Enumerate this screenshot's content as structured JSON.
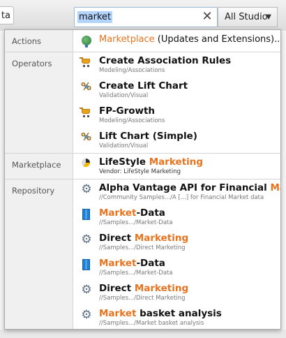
{
  "toolbar": {
    "prev_tab_label": "ta",
    "search": {
      "value": "market"
    },
    "scope_select": {
      "selected": "All Studio"
    }
  },
  "results": {
    "sections": [
      {
        "label": "Actions",
        "items": [
          {
            "icon": "globe-icon",
            "parts": [
              {
                "t": "Marketplace",
                "hl": true
              },
              {
                "t": " (Updates and Extensions)...",
                "hl": false
              }
            ],
            "subtitle": ""
          }
        ]
      },
      {
        "label": "Operators",
        "items": [
          {
            "icon": "cart-icon",
            "parts": [
              {
                "t": "Create Association Rules",
                "hl": false
              }
            ],
            "subtitle": "Modeling/Associations"
          },
          {
            "icon": "percent-icon",
            "parts": [
              {
                "t": "Create Lift Chart",
                "hl": false
              }
            ],
            "subtitle": "Validation/Visual"
          },
          {
            "icon": "cart-icon",
            "parts": [
              {
                "t": "FP-Growth",
                "hl": false
              }
            ],
            "subtitle": "Modeling/Associations"
          },
          {
            "icon": "percent-icon",
            "parts": [
              {
                "t": "Lift Chart (Simple)",
                "hl": false
              }
            ],
            "subtitle": "Validation/Visual"
          }
        ]
      },
      {
        "label": "Marketplace",
        "items": [
          {
            "icon": "pie-chart-icon",
            "parts": [
              {
                "t": "LifeStyle ",
                "hl": false
              },
              {
                "t": "Marketing",
                "hl": true
              }
            ],
            "subtitle": "Vendor: LifeStyle Marketing"
          }
        ]
      },
      {
        "label": "Repository",
        "items": [
          {
            "icon": "gear-icon",
            "parts": [
              {
                "t": "Alpha Vantage API for Financial ",
                "hl": false
              },
              {
                "t": "Ma",
                "hl": true
              }
            ],
            "subtitle": "//Community Samples.../A [...] for Financial Market data"
          },
          {
            "icon": "data-file-icon",
            "parts": [
              {
                "t": "Market",
                "hl": true
              },
              {
                "t": "-Data",
                "hl": false
              }
            ],
            "subtitle": "//Samples.../Market-Data"
          },
          {
            "icon": "gear-icon",
            "parts": [
              {
                "t": "Direct ",
                "hl": false
              },
              {
                "t": "Marketing",
                "hl": true
              }
            ],
            "subtitle": "//Samples.../Direct Marketing"
          },
          {
            "icon": "data-file-icon",
            "parts": [
              {
                "t": "Market",
                "hl": true
              },
              {
                "t": "-Data",
                "hl": false
              }
            ],
            "subtitle": "//Samples.../Market-Data"
          },
          {
            "icon": "gear-icon",
            "parts": [
              {
                "t": "Direct ",
                "hl": false
              },
              {
                "t": "Marketing",
                "hl": true
              }
            ],
            "subtitle": "//Samples.../Direct Marketing"
          },
          {
            "icon": "gear-icon",
            "parts": [
              {
                "t": "Market",
                "hl": true
              },
              {
                "t": " basket analysis",
                "hl": false
              }
            ],
            "subtitle": "//Samples.../Market basket analysis"
          }
        ]
      }
    ]
  },
  "colors": {
    "highlight": "#e8731e",
    "selection": "#b3d4fc"
  }
}
